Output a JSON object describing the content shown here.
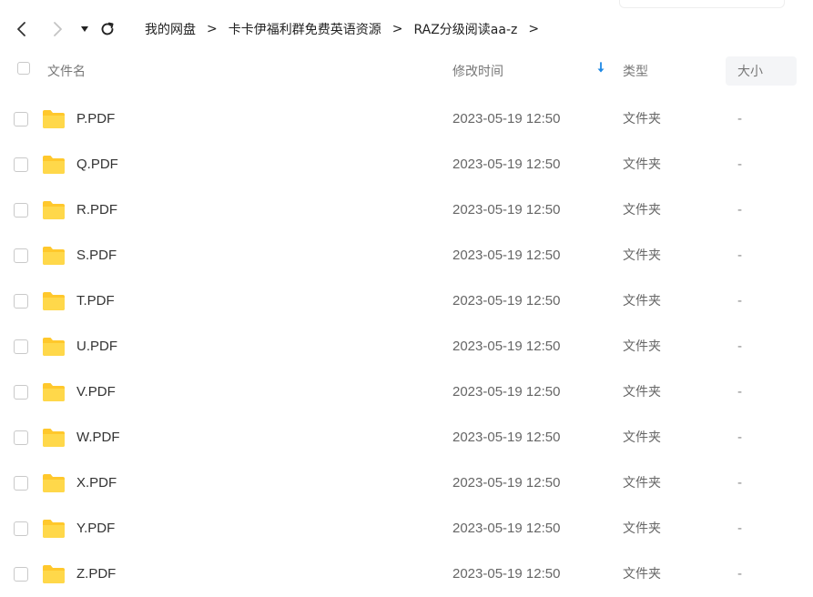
{
  "nav": {
    "back_icon": "chevron-left-icon",
    "forward_icon": "chevron-right-icon",
    "dropdown_icon": "caret-down-icon",
    "refresh_icon": "refresh-icon"
  },
  "breadcrumb": {
    "items": [
      "我的网盘",
      "卡卡伊福利群免费英语资源",
      "RAZ分级阅读aa-z"
    ],
    "separator": ">"
  },
  "table": {
    "columns": {
      "name": "文件名",
      "modified": "修改时间",
      "type": "类型",
      "size": "大小"
    },
    "sort_icon": "sort-down-arrow-icon",
    "accent_color": "#1e88e5",
    "folder_color": "#ffcb2d",
    "rows": [
      {
        "name": "P.PDF",
        "modified": "2023-05-19 12:50",
        "type": "文件夹",
        "size": "-"
      },
      {
        "name": "Q.PDF",
        "modified": "2023-05-19 12:50",
        "type": "文件夹",
        "size": "-"
      },
      {
        "name": "R.PDF",
        "modified": "2023-05-19 12:50",
        "type": "文件夹",
        "size": "-"
      },
      {
        "name": "S.PDF",
        "modified": "2023-05-19 12:50",
        "type": "文件夹",
        "size": "-"
      },
      {
        "name": "T.PDF",
        "modified": "2023-05-19 12:50",
        "type": "文件夹",
        "size": "-"
      },
      {
        "name": "U.PDF",
        "modified": "2023-05-19 12:50",
        "type": "文件夹",
        "size": "-"
      },
      {
        "name": "V.PDF",
        "modified": "2023-05-19 12:50",
        "type": "文件夹",
        "size": "-"
      },
      {
        "name": "W.PDF",
        "modified": "2023-05-19 12:50",
        "type": "文件夹",
        "size": "-"
      },
      {
        "name": "X.PDF",
        "modified": "2023-05-19 12:50",
        "type": "文件夹",
        "size": "-"
      },
      {
        "name": "Y.PDF",
        "modified": "2023-05-19 12:50",
        "type": "文件夹",
        "size": "-"
      },
      {
        "name": "Z.PDF",
        "modified": "2023-05-19 12:50",
        "type": "文件夹",
        "size": "-"
      }
    ]
  }
}
